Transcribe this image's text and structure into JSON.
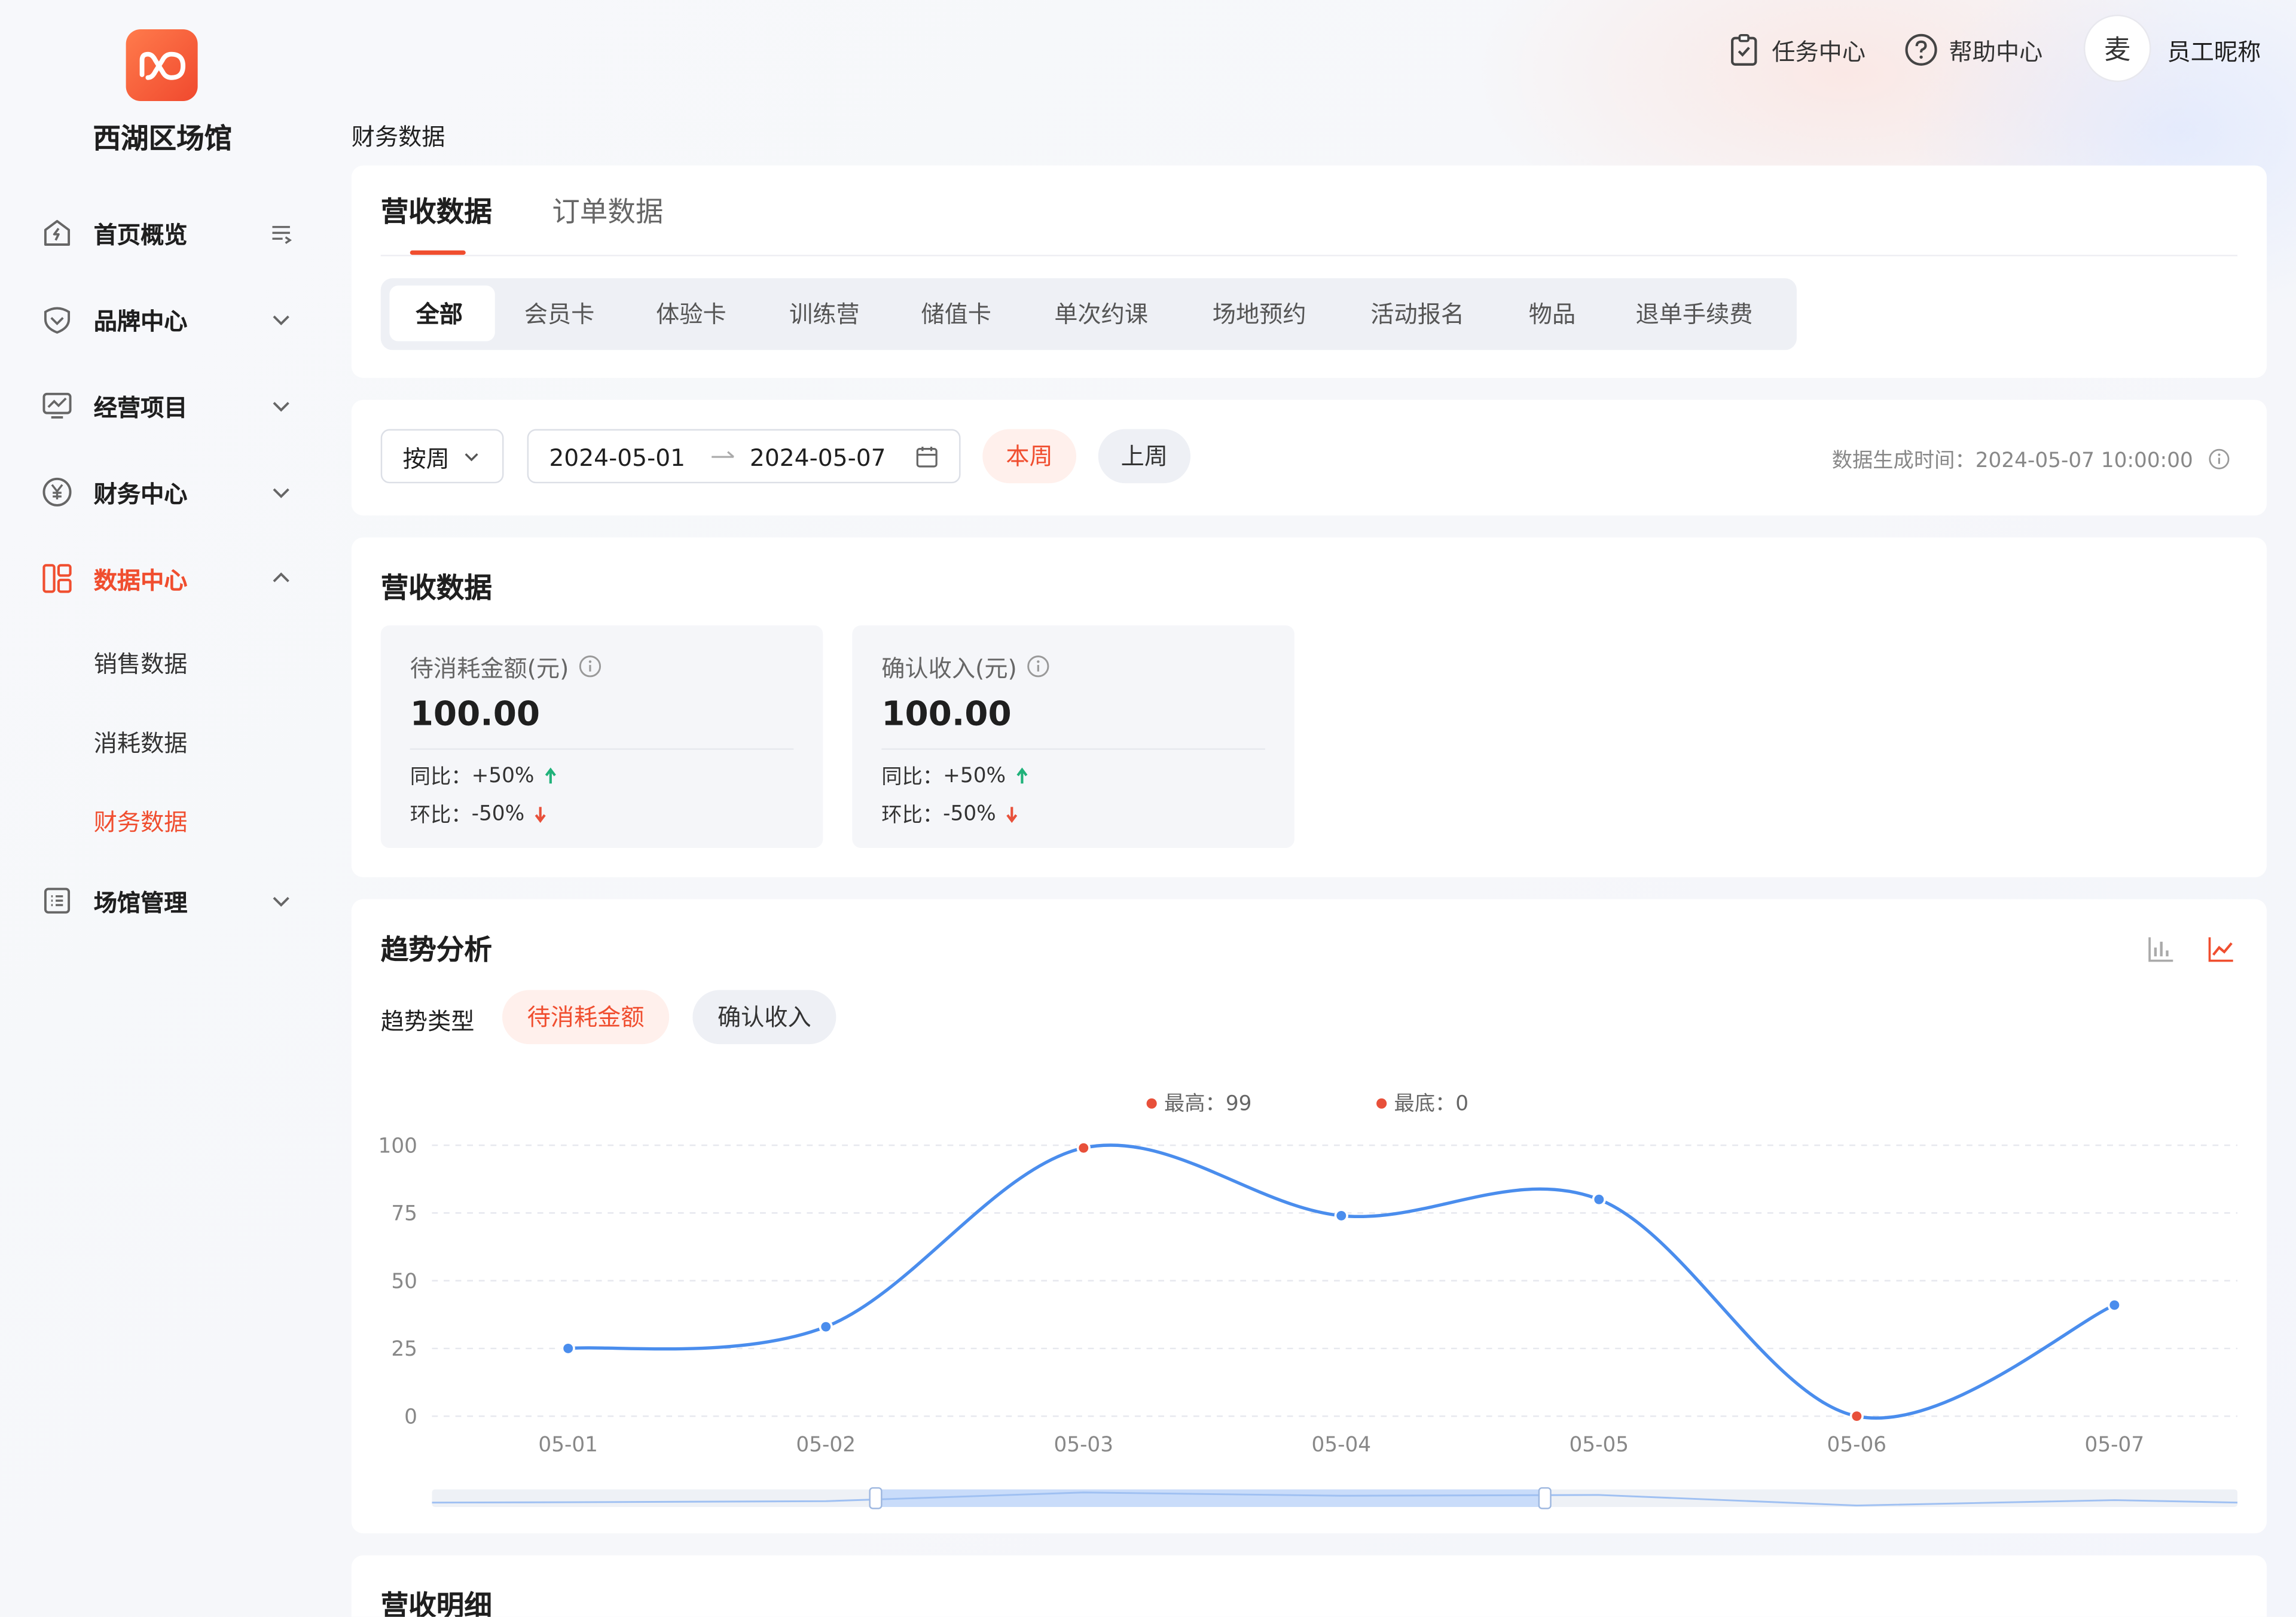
{
  "sidebar": {
    "venue": "西湖区场馆",
    "items": [
      {
        "label": "首页概览"
      },
      {
        "label": "品牌中心"
      },
      {
        "label": "经营项目"
      },
      {
        "label": "财务中心"
      },
      {
        "label": "数据中心"
      },
      {
        "label": "场馆管理"
      }
    ],
    "sub_items": [
      {
        "label": "销售数据"
      },
      {
        "label": "消耗数据"
      },
      {
        "label": "财务数据"
      }
    ]
  },
  "header": {
    "task_center": "任务中心",
    "help_center": "帮助中心",
    "avatar_text": "麦",
    "nickname": "员工昵称"
  },
  "page": {
    "title": "财务数据"
  },
  "main_tabs": [
    {
      "label": "营收数据"
    },
    {
      "label": "订单数据"
    }
  ],
  "segment_tabs": [
    {
      "label": "全部"
    },
    {
      "label": "会员卡"
    },
    {
      "label": "体验卡"
    },
    {
      "label": "训练营"
    },
    {
      "label": "储值卡"
    },
    {
      "label": "单次约课"
    },
    {
      "label": "场地预约"
    },
    {
      "label": "活动报名"
    },
    {
      "label": "物品"
    },
    {
      "label": "退单手续费"
    }
  ],
  "filter": {
    "period": "按周",
    "start_date": "2024-05-01",
    "end_date": "2024-05-07",
    "this_week": "本周",
    "last_week": "上周",
    "generated_label": "数据生成时间：",
    "generated_time": "2024-05-07 10:00:00"
  },
  "revenue": {
    "title": "营收数据",
    "cards": [
      {
        "title": "待消耗金额(元)",
        "value": "100.00",
        "yoy_label": "同比：",
        "yoy": "+50%",
        "mom_label": "环比：",
        "mom": "-50%"
      },
      {
        "title": "确认收入(元)",
        "value": "100.00",
        "yoy_label": "同比：",
        "yoy": "+50%",
        "mom_label": "环比：",
        "mom": "-50%"
      }
    ]
  },
  "trend": {
    "title": "趋势分析",
    "type_label": "趋势类型",
    "types": [
      {
        "label": "待消耗金额"
      },
      {
        "label": "确认收入"
      }
    ],
    "legend_high": "最高：99",
    "legend_low": "最底：0"
  },
  "chart_data": {
    "type": "line",
    "title": "",
    "xlabel": "",
    "ylabel": "",
    "categories": [
      "05-01",
      "05-02",
      "05-03",
      "05-04",
      "05-05",
      "05-06",
      "05-07"
    ],
    "series": [
      {
        "values": [
          25,
          33,
          99,
          74,
          80,
          0,
          41
        ]
      }
    ],
    "yticks": [
      0,
      25,
      50,
      75,
      100
    ],
    "ylim": [
      0,
      100
    ],
    "max_value": 99,
    "min_value": 0,
    "grid": true,
    "line_color": "#4a8ded",
    "extreme_color": "#e8503a"
  },
  "detail": {
    "title": "营收明细"
  },
  "colors": {
    "accent": "#f04e2f",
    "up": "#20b27a",
    "down": "#e8503a"
  }
}
